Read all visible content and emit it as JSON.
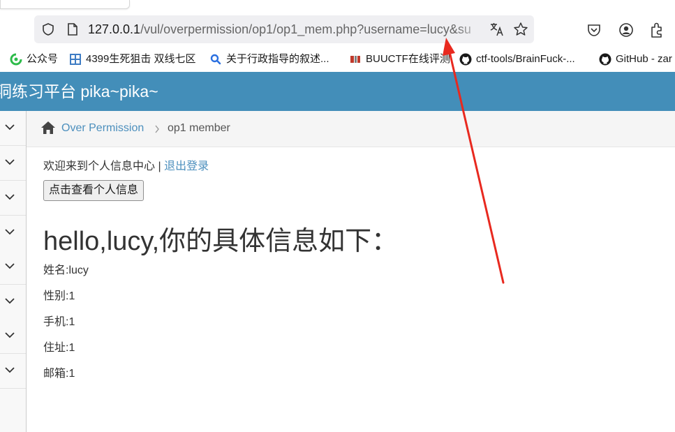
{
  "browser": {
    "url_host": "127.0.0.1",
    "url_path": "/vul/overpermission/op1/op1_mem.php?username=lucy&s",
    "url_tail": "u",
    "icons": [
      "shield-icon",
      "page-icon",
      "translate-icon",
      "star-icon",
      "pocket-icon",
      "account-icon",
      "extensions-icon"
    ],
    "bookmarks": [
      {
        "label": "公众号",
        "icon": "wechat-icon"
      },
      {
        "label": "4399生死狙击 双线七区",
        "icon": "grid-icon"
      },
      {
        "label": "关于行政指导的叙述...",
        "icon": "search-icon"
      },
      {
        "label": "BUUCTF在线评测",
        "icon": "buu-icon"
      },
      {
        "label": "ctf-tools/BrainFuck-...",
        "icon": "github-icon"
      },
      {
        "label": "GitHub - zar",
        "icon": "github-icon"
      }
    ]
  },
  "header": {
    "title": "洞练习平台 pika~pika~"
  },
  "breadcrumb": {
    "parent": "Over Permission",
    "current": "op1 member"
  },
  "content": {
    "welcome": "欢迎来到个人信息中心",
    "separator": " | ",
    "logout": "退出登录",
    "view_button": "点击查看个人信息",
    "hello": "hello,lucy,你的具体信息如下：",
    "fields": [
      "姓名:lucy",
      "性别:1",
      "手机:1",
      "住址:1",
      "邮箱:1"
    ]
  },
  "colors": {
    "header_bg": "#438eb9",
    "link": "#4c8fbd",
    "annotation_arrow": "#e8291f"
  }
}
